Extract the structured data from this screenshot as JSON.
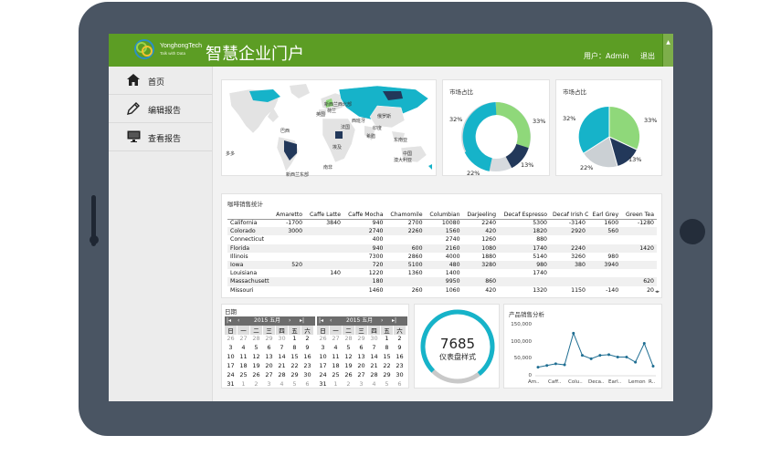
{
  "app": {
    "logo_name": "YonghongTech",
    "logo_tagline": "Talk with Data",
    "title": "智慧企业门户",
    "user_label": "用户：Admin",
    "logout_label": "退出"
  },
  "sidebar": {
    "items": [
      {
        "label": "首页",
        "icon": "home-icon"
      },
      {
        "label": "编辑报告",
        "icon": "edit-pencil-icon"
      },
      {
        "label": "查看报告",
        "icon": "monitor-icon"
      }
    ]
  },
  "map": {
    "labels": [
      "新西兰西北部",
      "荷兰",
      "英国",
      "俄罗斯",
      "西班牙",
      "法国",
      "巴西",
      "印度",
      "希腊",
      "东南亚",
      "澳大利亚",
      "多多",
      "埃及",
      "中国",
      "南非",
      "新西兰东部"
    ]
  },
  "pie1": {
    "title": "市场占比",
    "labels": [
      "32%",
      "33%",
      "13%",
      "22%"
    ]
  },
  "pie2": {
    "title": "市场占比",
    "labels": [
      "32%",
      "33%",
      "13%",
      "22%"
    ]
  },
  "sales_table": {
    "title": "咖啡销售统计",
    "columns": [
      "",
      "Amaretto",
      "Caffe Latte",
      "Caffe Mocha",
      "Chamomile",
      "Columbian",
      "Darjeeling",
      "Decaf Espresso",
      "Decaf Irish Cream",
      "Earl Grey",
      "Green Tea"
    ],
    "rows": [
      [
        "California",
        "-1700",
        "3840",
        "940",
        "2700",
        "10080",
        "2240",
        "5300",
        "-3140",
        "1600",
        "-1280"
      ],
      [
        "Colorado",
        "3000",
        "",
        "2740",
        "2260",
        "1560",
        "420",
        "1820",
        "2920",
        "560",
        ""
      ],
      [
        "Connecticut",
        "",
        "",
        "400",
        "",
        "2740",
        "1260",
        "880",
        "",
        "",
        ""
      ],
      [
        "Florida",
        "",
        "",
        "940",
        "600",
        "2160",
        "1080",
        "1740",
        "2240",
        "",
        "1420"
      ],
      [
        "Illinois",
        "",
        "",
        "7300",
        "2860",
        "4000",
        "1880",
        "5140",
        "3260",
        "980",
        ""
      ],
      [
        "Iowa",
        "520",
        "",
        "720",
        "5100",
        "480",
        "3280",
        "980",
        "380",
        "3940",
        ""
      ],
      [
        "Louisiana",
        "",
        "140",
        "1220",
        "1360",
        "1400",
        "",
        "1740",
        "",
        "",
        ""
      ],
      [
        "Massachusett",
        "",
        "",
        "180",
        "",
        "9950",
        "860",
        "",
        "",
        "",
        "620"
      ],
      [
        "Missouri",
        "",
        "",
        "1460",
        "260",
        "1060",
        "420",
        "1320",
        "1150",
        "-140",
        "20"
      ]
    ]
  },
  "calendar": {
    "title": "日期",
    "month_label": "2015 五月",
    "weekdays": [
      "日",
      "一",
      "二",
      "三",
      "四",
      "五",
      "六"
    ],
    "rows": [
      [
        "26",
        "27",
        "28",
        "29",
        "30",
        "1",
        "2"
      ],
      [
        "3",
        "4",
        "5",
        "6",
        "7",
        "8",
        "9"
      ],
      [
        "10",
        "11",
        "12",
        "13",
        "14",
        "15",
        "16"
      ],
      [
        "17",
        "18",
        "19",
        "20",
        "21",
        "22",
        "23"
      ],
      [
        "24",
        "25",
        "26",
        "27",
        "28",
        "29",
        "30"
      ],
      [
        "31",
        "1",
        "2",
        "3",
        "4",
        "5",
        "6"
      ]
    ]
  },
  "gauge": {
    "value": "7685",
    "label": "仪表盘样式",
    "fill_fraction": 0.77
  },
  "chart_data": {
    "type": "line",
    "title": "产品销售分析",
    "categories": [
      "Am..",
      "Caff..",
      "Colu..",
      "Deca..",
      "Earl..",
      "Lemon",
      "R.."
    ],
    "values": [
      25000,
      30000,
      35000,
      32000,
      125000,
      60000,
      50000,
      60000,
      62000,
      55000,
      55000,
      40000,
      95000,
      28000
    ],
    "yticks": [
      "150,000",
      "100,000",
      "50,000",
      "0"
    ],
    "ylim": [
      0,
      150000
    ],
    "color": "#1f6e92"
  },
  "colors": {
    "brand_green": "#5c9d24",
    "teal": "#16b3c9",
    "light_green": "#8fd87a",
    "navy": "#22385a",
    "grey": "#cbd0d4"
  }
}
